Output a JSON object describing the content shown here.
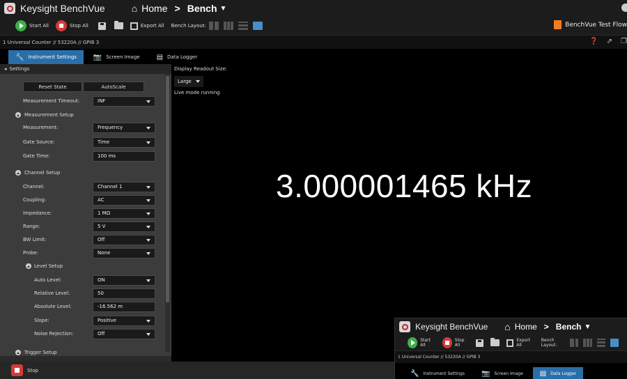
{
  "app": {
    "title": "Keysight BenchVue",
    "breadcrumb_home": "Home",
    "breadcrumb_sep": ">",
    "breadcrumb_bench": "Bench"
  },
  "toolbar": {
    "start_all": "Start All",
    "stop_all": "Stop All",
    "export_all": "Export All",
    "bench_layout": "Bench Layout:",
    "test_flow": "BenchVue Test Flow"
  },
  "instrument": {
    "header": "1 Universal Counter // 53220A // GPIB 3"
  },
  "tabs": [
    {
      "label": "Instrument Settings",
      "icon": "wrench-icon"
    },
    {
      "label": "Screen Image",
      "icon": "camera-icon"
    },
    {
      "label": "Data Logger",
      "icon": "data-logger-icon"
    }
  ],
  "settings": {
    "header": "Settings",
    "reset_state": "Reset State",
    "autoscale": "AutoScale",
    "timeout_label": "Measurement Timeout:",
    "timeout_value": "INF",
    "measurement_setup": "Measurement Setup",
    "measurement_label": "Measurement:",
    "measurement_value": "Frequency",
    "gate_source_label": "Gate Source:",
    "gate_source_value": "Time",
    "gate_time_label": "Gate Time:",
    "gate_time_value": "100 ms",
    "channel_setup": "Channel Setup",
    "channel_label": "Channel:",
    "channel_value": "Channel 1",
    "coupling_label": "Coupling:",
    "coupling_value": "AC",
    "impedance_label": "Impedance:",
    "impedance_value": "1 MΩ",
    "range_label": "Range:",
    "range_value": "5 V",
    "bw_limit_label": "BW Limit:",
    "bw_limit_value": "Off",
    "probe_label": "Probe:",
    "probe_value": "None",
    "level_setup": "Level Setup",
    "auto_level_label": "Auto Level:",
    "auto_level_value": "ON",
    "relative_level_label": "Relative Level:",
    "relative_level_value": "50",
    "absolute_level_label": "Absolute Level:",
    "absolute_level_value": "-16.562 m",
    "slope_label": "Slope:",
    "slope_value": "Positive",
    "noise_rejection_label": "Noise Rejection:",
    "noise_rejection_value": "Off",
    "trigger_setup": "Trigger Setup"
  },
  "display": {
    "readout_size_label": "Display Readout Size:",
    "readout_size_value": "Large",
    "live_status": "Live mode running",
    "reading": "3.000001465 kHz"
  },
  "bottom": {
    "stop_label": "Stop"
  },
  "colors": {
    "accent": "#2a6ea9",
    "start_green": "#3fae49",
    "stop_red": "#d23a3a",
    "testflow_orange": "#f07d22"
  }
}
